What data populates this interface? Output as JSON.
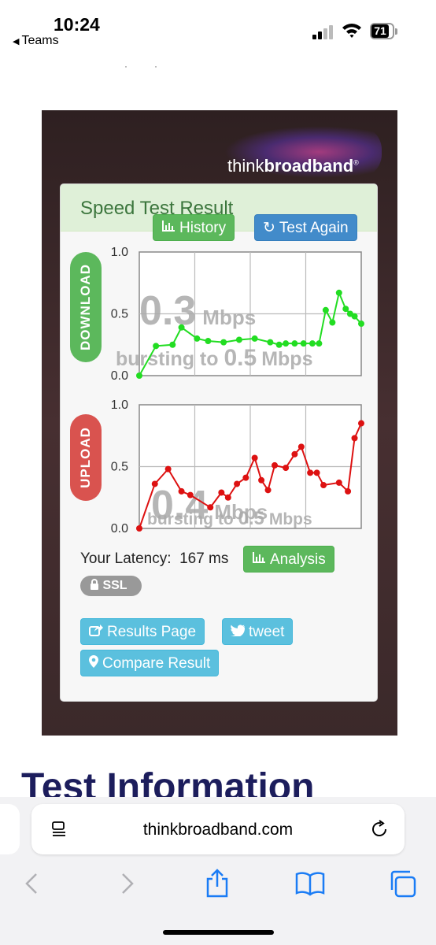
{
  "status_bar": {
    "time": "10:24",
    "back_app": "Teams",
    "battery": "71"
  },
  "brand": {
    "logo_text_light": "think",
    "logo_text_bold": "broadband",
    "logo_mark": "®"
  },
  "card": {
    "title": "Speed Test Result",
    "history_label": "History",
    "test_again_label": "Test Again"
  },
  "download": {
    "label": "DOWNLOAD",
    "speed_value": "0.3",
    "speed_unit": "Mbps",
    "burst_text": "bursting to ",
    "burst_value": "0.5",
    "burst_unit": "Mbps"
  },
  "upload": {
    "label": "UPLOAD",
    "speed_value": "0.4",
    "speed_unit": "Mbps",
    "burst_text": "bursting to ",
    "burst_value": "0.5",
    "burst_unit": "Mbps"
  },
  "latency": {
    "label": "Your Latency:",
    "value": "167 ms",
    "analysis_label": "Analysis"
  },
  "ssl_label": "SSL",
  "actions": {
    "results_page": "Results Page",
    "tweet": "tweet",
    "compare": "Compare Result"
  },
  "section_heading": "Test Information",
  "url_bar": {
    "domain": "thinkbroadband.com"
  },
  "colors": {
    "download_line": "#22dd22",
    "upload_line": "#dd1111",
    "success": "#5cb85c",
    "primary": "#428bca",
    "info": "#5bc0de",
    "danger": "#d9534f",
    "heading": "#1c1d5c"
  },
  "icons": [
    "bar-chart-icon",
    "refresh-icon",
    "share-icon",
    "twitter-icon",
    "map-marker-icon",
    "lock-icon",
    "reader-icon",
    "reload-icon",
    "back-icon",
    "forward-icon",
    "share-up-icon",
    "bookmarks-icon",
    "tabs-icon"
  ],
  "chart_data": [
    {
      "type": "line",
      "series": [
        {
          "name": "DOWNLOAD",
          "values": [
            0.0,
            0.24,
            0.25,
            0.39,
            0.3,
            0.28,
            0.27,
            0.29,
            0.3,
            0.27,
            0.25,
            0.26,
            0.26,
            0.26,
            0.26,
            0.26,
            0.53,
            0.43,
            0.67,
            0.54,
            0.5,
            0.48,
            0.42
          ]
        }
      ],
      "x": [
        0,
        0.075,
        0.15,
        0.19,
        0.26,
        0.31,
        0.38,
        0.45,
        0.52,
        0.59,
        0.63,
        0.66,
        0.7,
        0.74,
        0.78,
        0.81,
        0.84,
        0.87,
        0.9,
        0.93,
        0.95,
        0.97,
        1.0
      ],
      "ylim": [
        0,
        1
      ],
      "y_ticks": [
        "1.0",
        "0.5",
        "0.0"
      ],
      "grid": true
    },
    {
      "type": "line",
      "series": [
        {
          "name": "UPLOAD",
          "values": [
            0.0,
            0.36,
            0.48,
            0.3,
            0.27,
            0.17,
            0.29,
            0.25,
            0.36,
            0.41,
            0.57,
            0.39,
            0.31,
            0.51,
            0.49,
            0.6,
            0.66,
            0.45,
            0.45,
            0.35,
            0.37,
            0.3,
            0.73,
            0.85
          ]
        }
      ],
      "x": [
        0,
        0.07,
        0.13,
        0.19,
        0.23,
        0.32,
        0.37,
        0.4,
        0.44,
        0.48,
        0.52,
        0.55,
        0.58,
        0.61,
        0.66,
        0.7,
        0.73,
        0.77,
        0.8,
        0.83,
        0.9,
        0.94,
        0.97,
        1.0
      ],
      "ylim": [
        0,
        1
      ],
      "y_ticks": [
        "1.0",
        "0.5",
        "0.0"
      ],
      "grid": true
    }
  ]
}
